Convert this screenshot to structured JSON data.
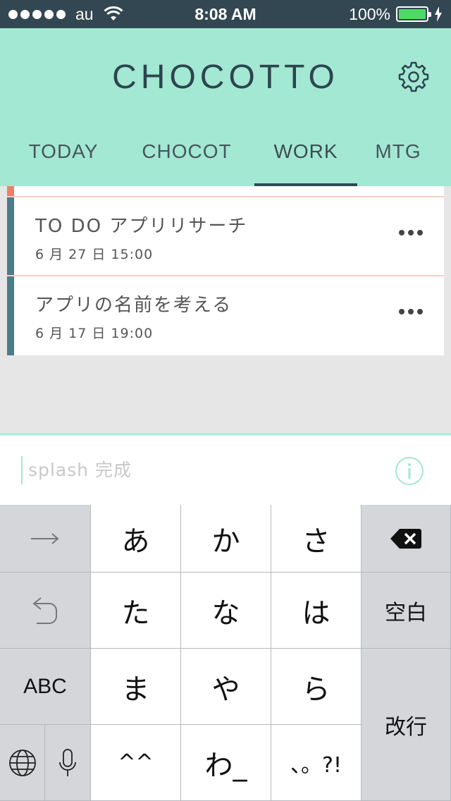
{
  "status_bar": {
    "carrier": "au",
    "time": "8:08 AM",
    "battery_percent": "100%",
    "battery_level": 1.0,
    "signal_bars": 5
  },
  "header": {
    "logo": "CHOCOTTO",
    "settings_icon": "gear-icon",
    "brand_color": "#a3e8d2",
    "tabs": [
      {
        "label": "TODAY",
        "active": false
      },
      {
        "label": "CHOCOT",
        "active": false
      },
      {
        "label": "WORK",
        "active": true
      },
      {
        "label": "MTG",
        "active": false
      }
    ]
  },
  "tasks": [
    {
      "title": "TO DO アプリリサーチ",
      "date": "6 月 27 日 15:00",
      "more_icon": "more-dots-icon"
    },
    {
      "title": "アプリの名前を考える",
      "date": "6 月 17 日 19:00",
      "more_icon": "more-dots-icon"
    }
  ],
  "input": {
    "placeholder": "splash 完成",
    "value": "",
    "info_icon": "info-icon"
  },
  "keyboard": {
    "row1": [
      "→",
      "あ",
      "か",
      "さ",
      "⌫"
    ],
    "row2": [
      "↩",
      "た",
      "な",
      "は",
      "空白"
    ],
    "row3": [
      "ABC",
      "ま",
      "や",
      "ら",
      "改行"
    ],
    "row4": [
      "🌐",
      "🎤",
      "^^",
      "わ_",
      "、。?!"
    ]
  }
}
